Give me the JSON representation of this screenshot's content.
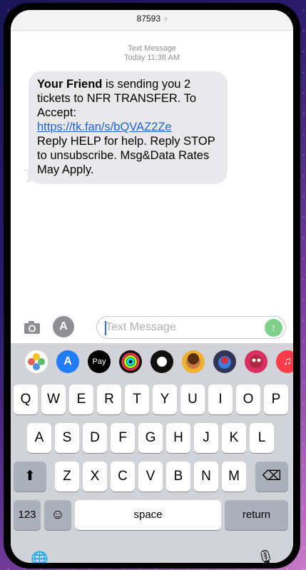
{
  "header": {
    "contact": "87593",
    "chevron": "›"
  },
  "meta": {
    "line1": "Text Message",
    "line2": "Today 11:38 AM"
  },
  "message": {
    "sender_bold": "Your Friend",
    "text_before_link": " is sending you 2 tickets to NFR TRANSFER. To Accept:",
    "link": "https://tk.fan/s/bQVAZ2Ze",
    "text_after_link": "Reply HELP for help. Reply STOP to unsubscribe. Msg&Data Rates May Apply."
  },
  "input": {
    "placeholder": "Text Message",
    "send_icon": "↑"
  },
  "app_strip": [
    {
      "name": "photos-app-icon",
      "color": "#ffffff"
    },
    {
      "name": "app-store-icon",
      "color": "#1f7cf6"
    },
    {
      "name": "apple-pay-icon",
      "color": "#000000",
      "label": "Pay"
    },
    {
      "name": "fitness-icon",
      "color": "#111111"
    },
    {
      "name": "record-icon",
      "color": "#111111"
    },
    {
      "name": "memoji-icon",
      "color": "#f0b030"
    },
    {
      "name": "animoji-icon",
      "color": "#333355"
    },
    {
      "name": "sticker-icon",
      "color": "#d83060"
    },
    {
      "name": "heart-icon",
      "color": "#111111"
    },
    {
      "name": "music-icon",
      "color": "#ff3b4a"
    }
  ],
  "keyboard": {
    "row1": [
      "Q",
      "W",
      "E",
      "R",
      "T",
      "Y",
      "U",
      "I",
      "O",
      "P"
    ],
    "row2": [
      "A",
      "S",
      "D",
      "F",
      "G",
      "H",
      "J",
      "K",
      "L"
    ],
    "row3": [
      "Z",
      "X",
      "C",
      "V",
      "B",
      "N",
      "M"
    ],
    "shift": "⬆",
    "backspace": "⌫",
    "numbers": "123",
    "emoji": "☺",
    "space": "space",
    "return": "return",
    "globe": "🌐",
    "mic": "🎙"
  }
}
